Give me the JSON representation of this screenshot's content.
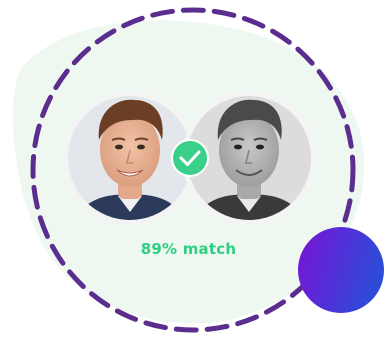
{
  "match": {
    "label": "89% match",
    "percent": 89
  },
  "icons": {
    "badge": "checkmark-icon",
    "left_photo": "face-photo-color",
    "right_photo": "face-photo-grayscale"
  },
  "colors": {
    "dashed_ring": "#5b2d8e",
    "blob_background": "#eef8f1",
    "match_text": "#2fcf83",
    "check_badge": "#3ad08a",
    "orb_start": "#7a12d6",
    "orb_end": "#2e4bd8"
  }
}
